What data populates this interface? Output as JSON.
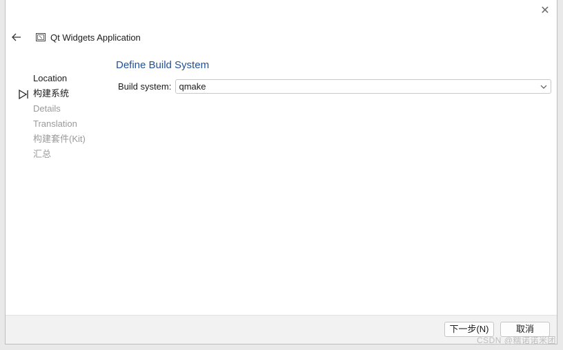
{
  "window": {
    "title": "Qt Widgets Application",
    "close_icon": "close-icon",
    "back_icon": "arrow-left-icon",
    "app_icon": "qt-app-icon"
  },
  "steps": [
    {
      "label": "Location",
      "state": "done"
    },
    {
      "label": "构建系统",
      "state": "current"
    },
    {
      "label": "Details",
      "state": "pending"
    },
    {
      "label": "Translation",
      "state": "pending"
    },
    {
      "label": "构建套件(Kit)",
      "state": "pending"
    },
    {
      "label": "汇总",
      "state": "pending"
    }
  ],
  "page": {
    "title": "Define Build System",
    "build_system_label": "Build system:",
    "build_system_value": "qmake"
  },
  "footer": {
    "next_label": "下一步(N)",
    "cancel_label": "取消"
  },
  "watermark": "CSDN @糯诺诺米团",
  "colors": {
    "title_blue": "#1f4f9c",
    "pending_text": "#9a9a9a"
  }
}
